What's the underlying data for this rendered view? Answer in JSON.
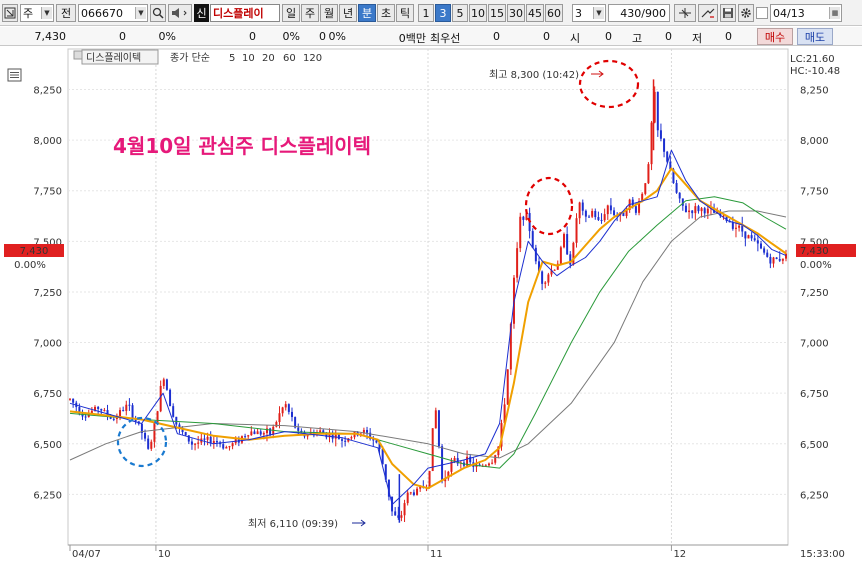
{
  "toolbar": {
    "type_value": "주",
    "all_label": "전",
    "code_value": "066670",
    "new_badge": "신",
    "stock_name": "디스플레이",
    "periods": [
      "일",
      "주",
      "월",
      "년",
      "분",
      "초",
      "틱"
    ],
    "selected_period": "분",
    "intervals": [
      "1",
      "3",
      "5",
      "10",
      "15",
      "30",
      "45",
      "60"
    ],
    "selected_interval": "3",
    "interval_input": "3",
    "count_display": "430/900",
    "date_value": "04/13"
  },
  "quote": {
    "price": "7,430",
    "change": "0",
    "change_pct": "0%",
    "v1": "0",
    "v1_pct": "0%",
    "v2": "0",
    "v2_pct": "0%",
    "volume": "0백만",
    "best_ask_label": "최우선",
    "best_ask": "0",
    "best_bid": "0",
    "open_label": "시",
    "open": "0",
    "high_label": "고",
    "high": "0",
    "low_label": "저",
    "low": "0",
    "buy_label": "매수",
    "sell_label": "매도"
  },
  "legend": {
    "stock_label": "디스플레이텍",
    "ma_title": "종가 단순",
    "ma_periods": [
      "5",
      "10",
      "20",
      "60",
      "120"
    ]
  },
  "annotation": {
    "title": "4월10일 관심주 디스플레이텍",
    "high_text": "최고 8,300 (10:42)",
    "low_text": "최저 6,110 (09:39)"
  },
  "right_info": {
    "lc": "LC:21.60",
    "hc": "HC:-10.48"
  },
  "current_price": {
    "price": "7,430",
    "pct": "0.00%"
  },
  "colors": {
    "up": "#e0201a",
    "down": "#1c2fd0",
    "ma5": "#1c2fd0",
    "ma10": "#2a2ab0",
    "ma20": "#f0a000",
    "ma60": "#2a9a3a",
    "ma120": "#7a7a7a",
    "annotation_text": "#e6197a",
    "high_circle": "#e00000",
    "low_circle": "#1a7ad0",
    "price_tag": "#e02020"
  },
  "chart_data": {
    "type": "candlestick",
    "y_ticks": [
      "8,250",
      "8,000",
      "7,750",
      "7,500",
      "7,250",
      "7,000",
      "6,750",
      "6,500",
      "6,250"
    ],
    "y_tick_values": [
      8250,
      8000,
      7750,
      7500,
      7250,
      7000,
      6750,
      6500,
      6250
    ],
    "ylim": [
      6000,
      8450
    ],
    "x_labels": [
      "04/07",
      "10",
      "11",
      "12"
    ],
    "x_label_positions": [
      0,
      0.12,
      0.5,
      0.84
    ],
    "time_label": "15:33:00",
    "xlim": [
      0,
      1
    ],
    "high": 8300,
    "low": 6110,
    "ma5": [
      [
        0,
        6700
      ],
      [
        0.05,
        6650
      ],
      [
        0.1,
        6600
      ],
      [
        0.13,
        6750
      ],
      [
        0.15,
        6550
      ],
      [
        0.2,
        6500
      ],
      [
        0.25,
        6520
      ],
      [
        0.3,
        6560
      ],
      [
        0.33,
        6550
      ],
      [
        0.38,
        6530
      ],
      [
        0.43,
        6480
      ],
      [
        0.45,
        6200
      ],
      [
        0.48,
        6300
      ],
      [
        0.5,
        6380
      ],
      [
        0.55,
        6420
      ],
      [
        0.58,
        6450
      ],
      [
        0.6,
        6600
      ],
      [
        0.62,
        7200
      ],
      [
        0.64,
        7500
      ],
      [
        0.66,
        7400
      ],
      [
        0.68,
        7330
      ],
      [
        0.7,
        7380
      ],
      [
        0.72,
        7420
      ],
      [
        0.74,
        7500
      ],
      [
        0.76,
        7600
      ],
      [
        0.78,
        7680
      ],
      [
        0.8,
        7700
      ],
      [
        0.82,
        7720
      ],
      [
        0.84,
        7950
      ],
      [
        0.86,
        7800
      ],
      [
        0.88,
        7700
      ],
      [
        0.9,
        7650
      ],
      [
        0.92,
        7600
      ],
      [
        0.94,
        7580
      ],
      [
        0.96,
        7530
      ],
      [
        0.98,
        7460
      ],
      [
        1,
        7430
      ]
    ],
    "ma20": [
      [
        0,
        6660
      ],
      [
        0.05,
        6640
      ],
      [
        0.1,
        6620
      ],
      [
        0.15,
        6580
      ],
      [
        0.2,
        6540
      ],
      [
        0.25,
        6520
      ],
      [
        0.3,
        6540
      ],
      [
        0.35,
        6550
      ],
      [
        0.4,
        6550
      ],
      [
        0.43,
        6520
      ],
      [
        0.45,
        6400
      ],
      [
        0.48,
        6300
      ],
      [
        0.5,
        6280
      ],
      [
        0.55,
        6380
      ],
      [
        0.58,
        6420
      ],
      [
        0.6,
        6480
      ],
      [
        0.62,
        6800
      ],
      [
        0.64,
        7200
      ],
      [
        0.66,
        7400
      ],
      [
        0.68,
        7380
      ],
      [
        0.7,
        7400
      ],
      [
        0.72,
        7480
      ],
      [
        0.74,
        7560
      ],
      [
        0.76,
        7620
      ],
      [
        0.78,
        7660
      ],
      [
        0.8,
        7700
      ],
      [
        0.82,
        7750
      ],
      [
        0.84,
        7860
      ],
      [
        0.86,
        7780
      ],
      [
        0.88,
        7700
      ],
      [
        0.9,
        7660
      ],
      [
        0.92,
        7620
      ],
      [
        0.94,
        7580
      ],
      [
        0.96,
        7540
      ],
      [
        0.98,
        7490
      ],
      [
        1,
        7440
      ]
    ],
    "ma60": [
      [
        0,
        6650
      ],
      [
        0.1,
        6620
      ],
      [
        0.2,
        6600
      ],
      [
        0.3,
        6560
      ],
      [
        0.4,
        6550
      ],
      [
        0.45,
        6500
      ],
      [
        0.5,
        6450
      ],
      [
        0.55,
        6400
      ],
      [
        0.6,
        6380
      ],
      [
        0.62,
        6450
      ],
      [
        0.65,
        6650
      ],
      [
        0.7,
        7000
      ],
      [
        0.74,
        7250
      ],
      [
        0.78,
        7450
      ],
      [
        0.82,
        7580
      ],
      [
        0.86,
        7700
      ],
      [
        0.9,
        7720
      ],
      [
        0.94,
        7690
      ],
      [
        0.97,
        7620
      ],
      [
        1,
        7560
      ]
    ],
    "ma120": [
      [
        0,
        6420
      ],
      [
        0.05,
        6500
      ],
      [
        0.1,
        6560
      ],
      [
        0.2,
        6600
      ],
      [
        0.3,
        6590
      ],
      [
        0.4,
        6560
      ],
      [
        0.5,
        6500
      ],
      [
        0.55,
        6450
      ],
      [
        0.6,
        6430
      ],
      [
        0.64,
        6500
      ],
      [
        0.7,
        6700
      ],
      [
        0.76,
        7000
      ],
      [
        0.8,
        7300
      ],
      [
        0.84,
        7500
      ],
      [
        0.88,
        7620
      ],
      [
        0.92,
        7650
      ],
      [
        0.96,
        7650
      ],
      [
        1,
        7620
      ]
    ],
    "price_path": [
      [
        0,
        6720
      ],
      [
        0.02,
        6640
      ],
      [
        0.04,
        6680
      ],
      [
        0.06,
        6620
      ],
      [
        0.08,
        6690
      ],
      [
        0.1,
        6560
      ],
      [
        0.11,
        6460
      ],
      [
        0.12,
        6620
      ],
      [
        0.13,
        6850
      ],
      [
        0.14,
        6700
      ],
      [
        0.15,
        6580
      ],
      [
        0.17,
        6500
      ],
      [
        0.2,
        6520
      ],
      [
        0.22,
        6480
      ],
      [
        0.25,
        6560
      ],
      [
        0.28,
        6550
      ],
      [
        0.3,
        6700
      ],
      [
        0.32,
        6540
      ],
      [
        0.35,
        6560
      ],
      [
        0.38,
        6520
      ],
      [
        0.41,
        6560
      ],
      [
        0.43,
        6500
      ],
      [
        0.44,
        6350
      ],
      [
        0.45,
        6160
      ],
      [
        0.46,
        6110
      ],
      [
        0.47,
        6250
      ],
      [
        0.48,
        6260
      ],
      [
        0.5,
        6300
      ],
      [
        0.51,
        6700
      ],
      [
        0.52,
        6300
      ],
      [
        0.53,
        6400
      ],
      [
        0.55,
        6420
      ],
      [
        0.57,
        6380
      ],
      [
        0.59,
        6420
      ],
      [
        0.6,
        6500
      ],
      [
        0.61,
        6800
      ],
      [
        0.62,
        7300
      ],
      [
        0.63,
        7650
      ],
      [
        0.64,
        7600
      ],
      [
        0.65,
        7400
      ],
      [
        0.66,
        7300
      ],
      [
        0.67,
        7350
      ],
      [
        0.68,
        7380
      ],
      [
        0.69,
        7520
      ],
      [
        0.7,
        7380
      ],
      [
        0.71,
        7700
      ],
      [
        0.72,
        7600
      ],
      [
        0.73,
        7650
      ],
      [
        0.74,
        7580
      ],
      [
        0.75,
        7680
      ],
      [
        0.76,
        7640
      ],
      [
        0.77,
        7620
      ],
      [
        0.78,
        7700
      ],
      [
        0.79,
        7650
      ],
      [
        0.8,
        7750
      ],
      [
        0.81,
        7900
      ],
      [
        0.815,
        8300
      ],
      [
        0.82,
        8050
      ],
      [
        0.83,
        7950
      ],
      [
        0.84,
        7820
      ],
      [
        0.85,
        7700
      ],
      [
        0.86,
        7650
      ],
      [
        0.88,
        7660
      ],
      [
        0.9,
        7640
      ],
      [
        0.92,
        7600
      ],
      [
        0.94,
        7550
      ],
      [
        0.96,
        7480
      ],
      [
        0.98,
        7400
      ],
      [
        1,
        7430
      ]
    ]
  }
}
